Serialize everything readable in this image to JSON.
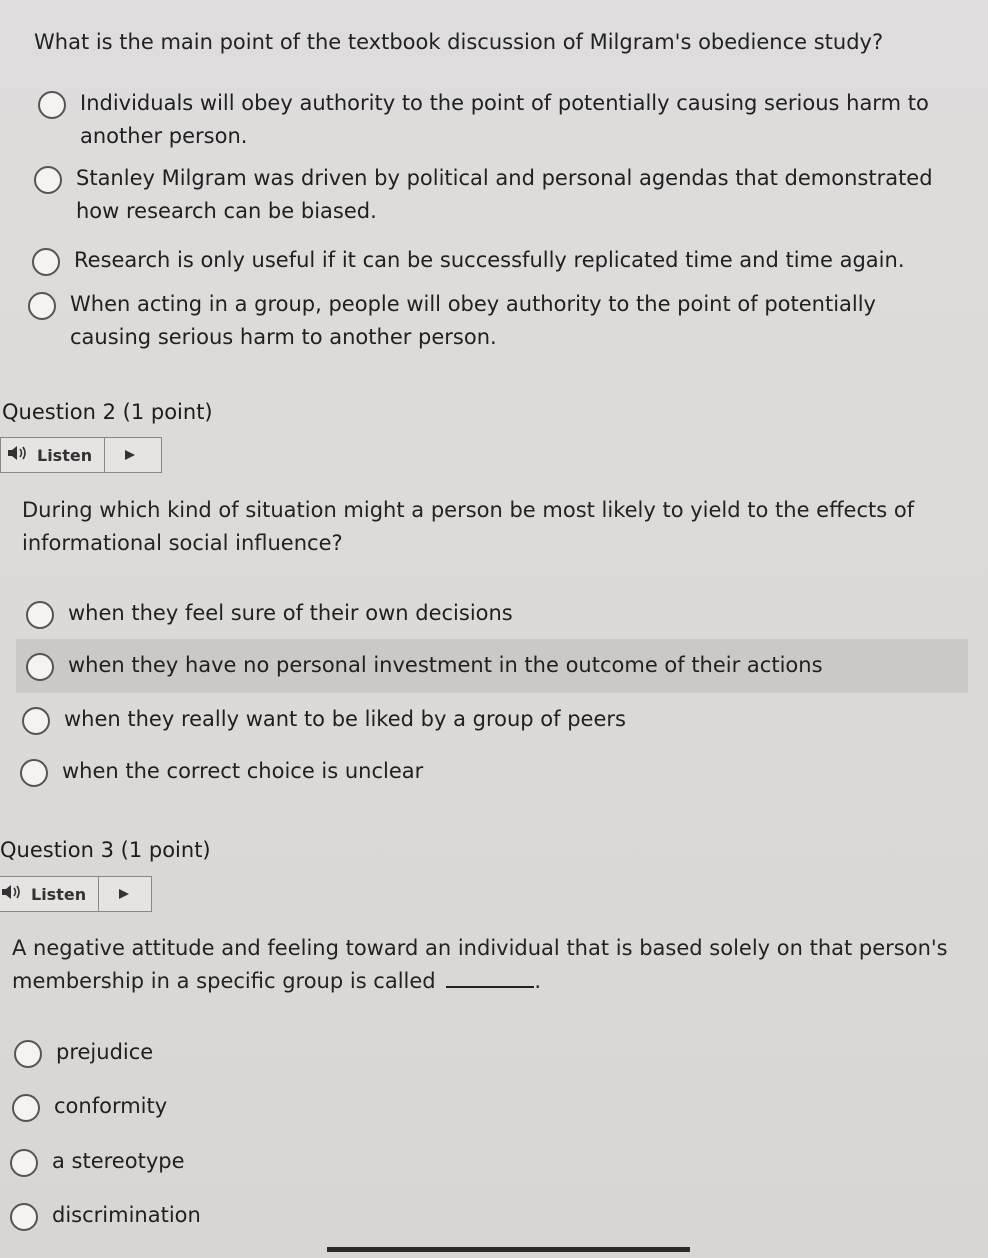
{
  "q1": {
    "prompt": "What is the main point of the textbook discussion of Milgram's obedience study?",
    "options": [
      "Individuals will obey authority to the point of potentially causing serious harm to another person.",
      "Stanley Milgram was driven by political and personal agendas that demonstrated how research can be biased.",
      "Research is only useful if it can be successfully replicated time and time again.",
      "When acting in a group, people will obey authority to the point of potentially causing serious harm to another person."
    ]
  },
  "q2": {
    "heading": "Question 2 (1 point)",
    "listen_label": "Listen",
    "prompt": "During which kind of situation might a person be most likely to yield to the effects of informational social influence?",
    "options": [
      "when they feel sure of their own decisions",
      "when they have no personal investment in the outcome of their actions",
      "when they really want to be liked by a group of peers",
      "when the correct choice is unclear"
    ]
  },
  "q3": {
    "heading": "Question 3 (1 point)",
    "listen_label": "Listen",
    "prompt": "A negative attitude and feeling toward an individual that is based solely on that person's membership in a specific group is called",
    "prompt_end": ".",
    "options": [
      "prejudice",
      "conformity",
      "a stereotype",
      "discrimination"
    ]
  },
  "icons": {
    "speaker": "speaker-icon",
    "play": "play-icon"
  }
}
